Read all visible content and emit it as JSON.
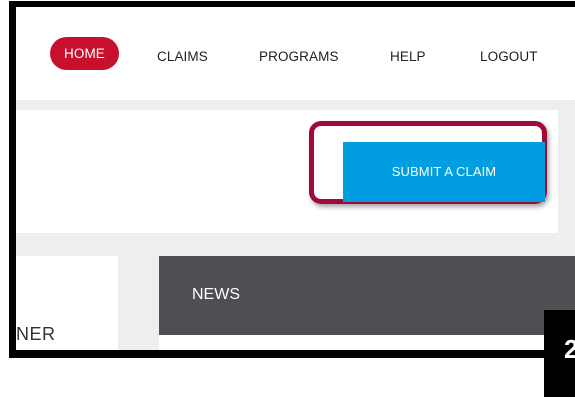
{
  "nav": {
    "items": [
      {
        "label": "HOME",
        "active": true
      },
      {
        "label": "CLAIMS",
        "active": false
      },
      {
        "label": "PROGRAMS",
        "active": false
      },
      {
        "label": "HELP",
        "active": false
      },
      {
        "label": "LOGOUT",
        "active": false
      }
    ]
  },
  "banner": {
    "submit_label": "SUBMIT A CLAIM"
  },
  "left_card": {
    "text": "NER"
  },
  "news": {
    "title": "NEWS"
  },
  "corner": {
    "glyph": "2"
  },
  "colors": {
    "brand_red": "#c8102e",
    "highlight_border": "#a3093a",
    "submit_blue": "#009ee0",
    "news_header": "#4d4f53",
    "page_bg": "#eeeeee"
  }
}
